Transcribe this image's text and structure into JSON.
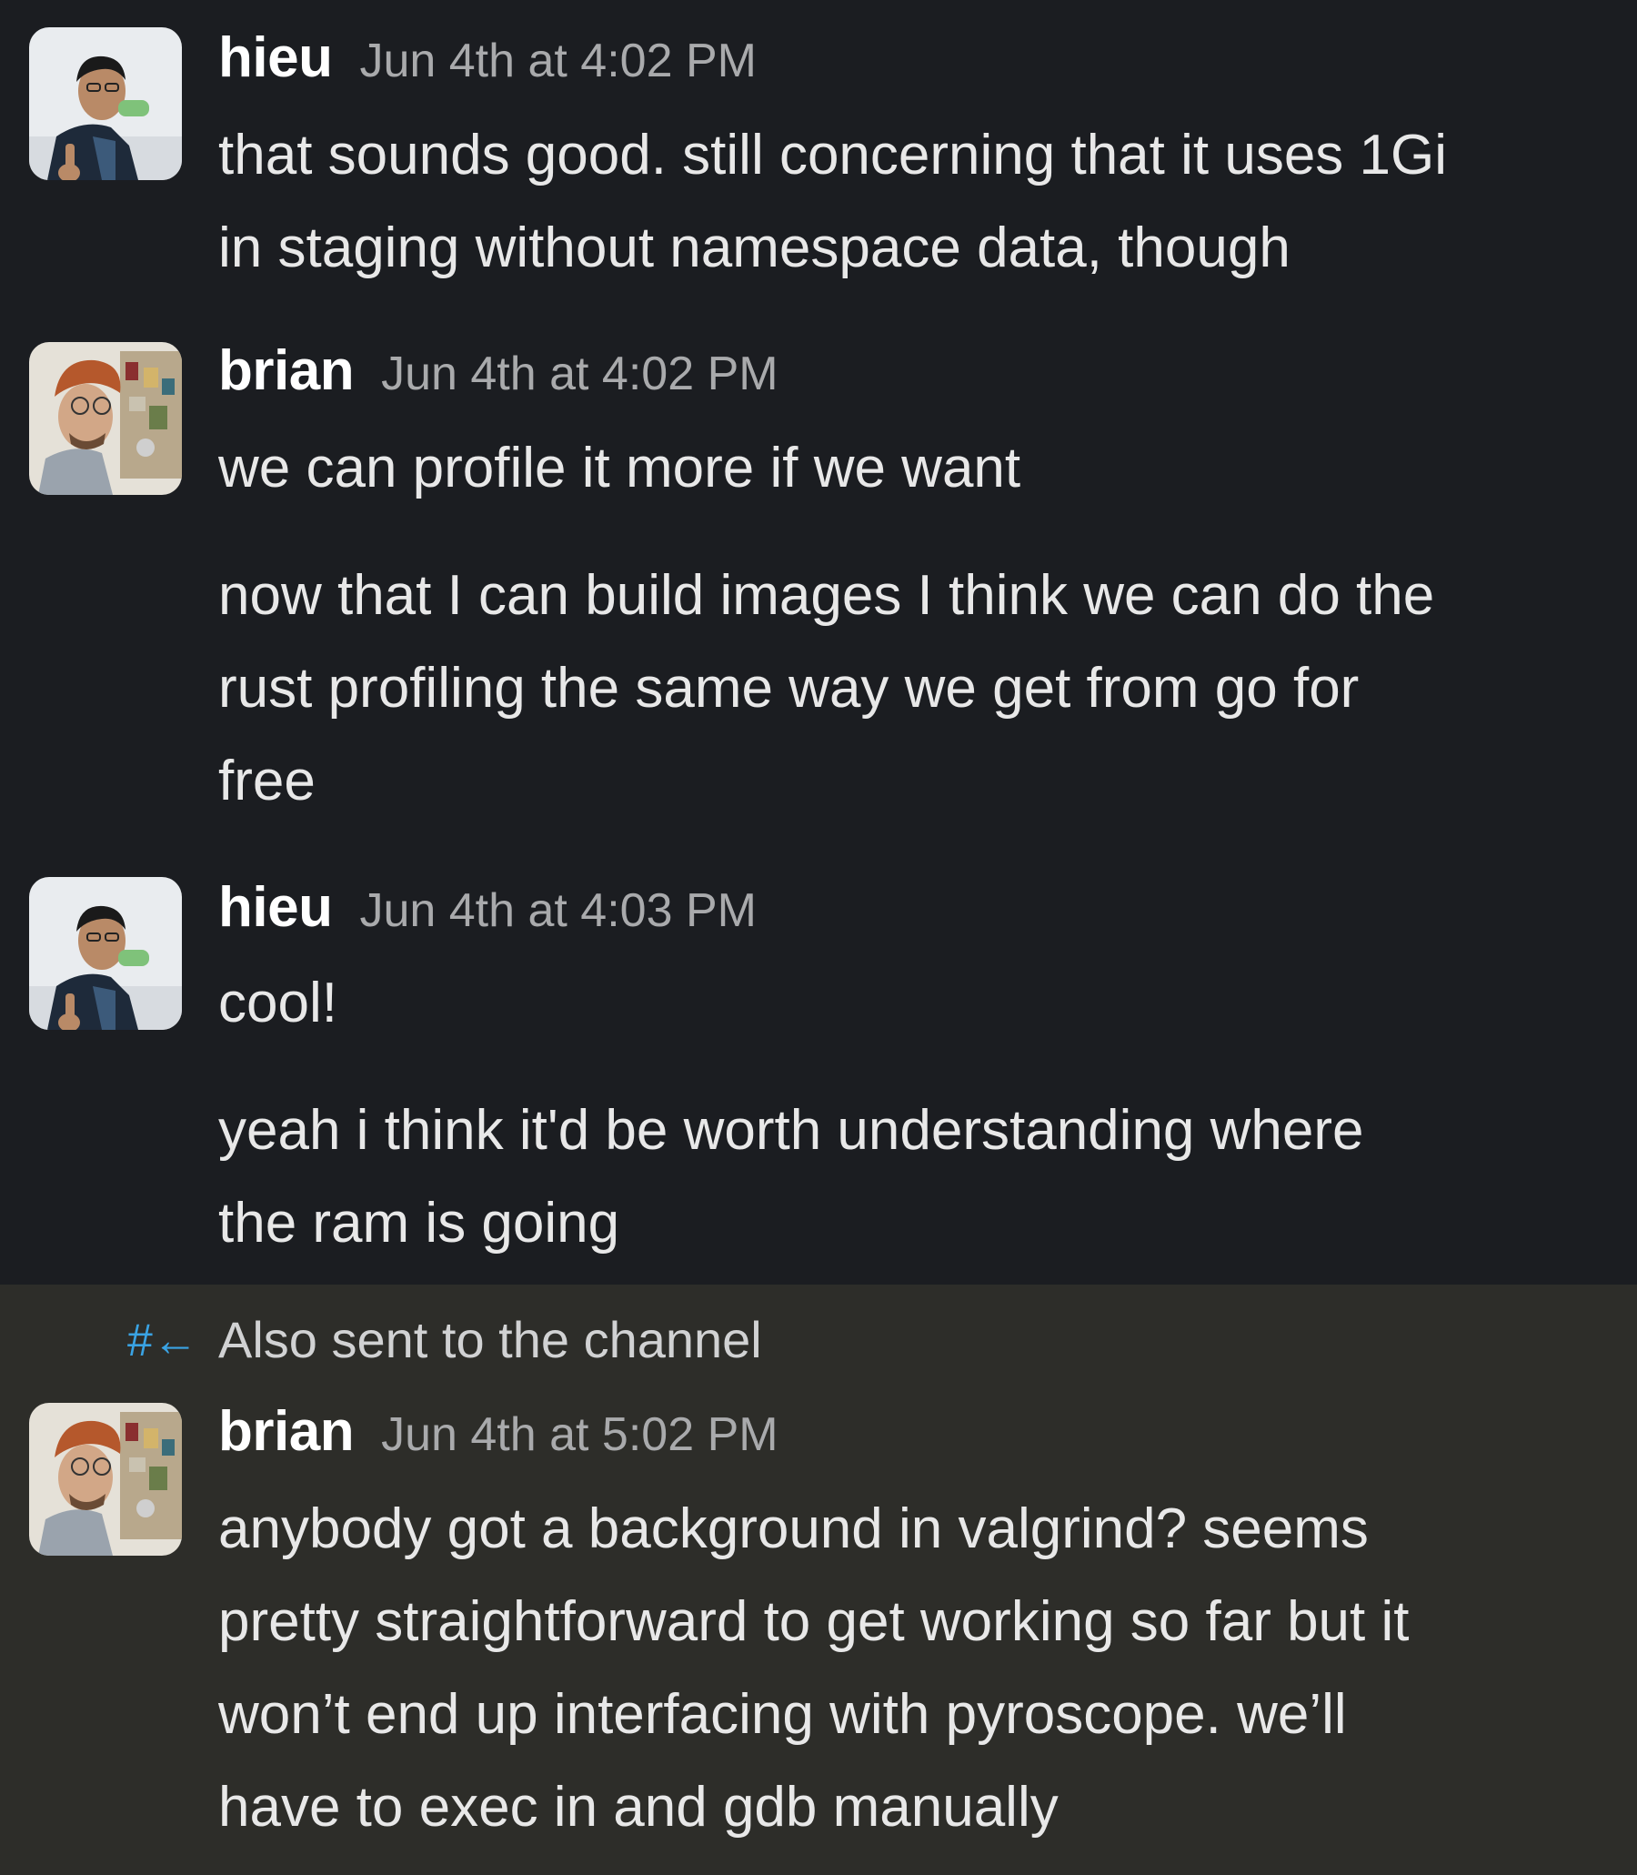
{
  "messages": [
    {
      "author": "hieu",
      "time": "Jun 4th at 4:02 PM",
      "lines": [
        "that sounds good. still concerning that it uses 1Gi",
        "in staging without namespace data, though"
      ]
    },
    {
      "author": "brian",
      "time": "Jun 4th at 4:02 PM",
      "lines": [
        "we can profile it more if we want",
        "now that I can build images I think we can do the",
        "rust profiling the same way we get from go for",
        "free"
      ]
    },
    {
      "author": "hieu",
      "time": "Jun 4th at 4:03 PM",
      "lines": [
        "cool!",
        "yeah i think it'd be worth understanding where",
        "the ram is going"
      ]
    },
    {
      "author": "brian",
      "time": "Jun 4th at 5:02 PM",
      "lines": [
        "anybody got a background in valgrind? seems",
        "pretty straightforward to get working so far but it",
        "won’t end up interfacing with pyroscope. we’ll",
        "have to exec in and gdb manually"
      ]
    }
  ],
  "also_sent": {
    "icon": "channel-return-icon",
    "glyph": "#←",
    "label": "Also sent to the channel"
  },
  "colors": {
    "background": "#1b1d21",
    "highlight": "#2d2d29",
    "author": "#ffffff",
    "timestamp": "#a9aaac",
    "text": "#e8e8e8",
    "accent": "#3aa3e3"
  }
}
